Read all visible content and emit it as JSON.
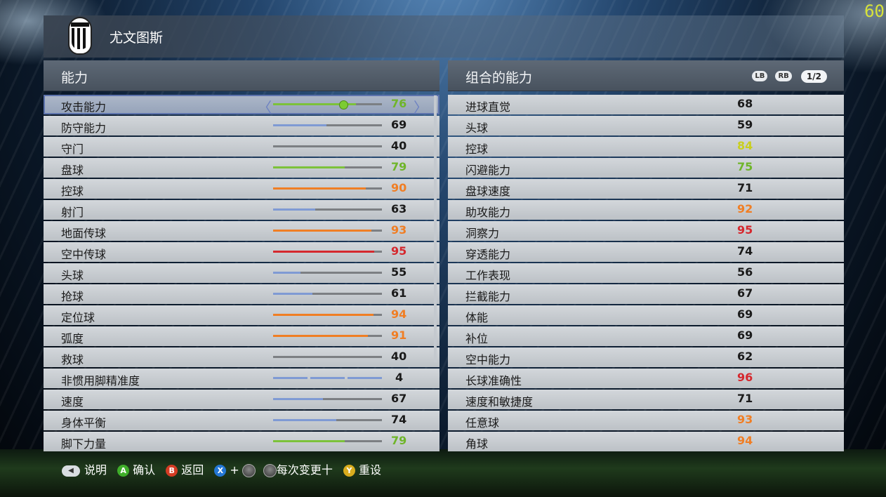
{
  "fps": "60",
  "header": {
    "team_name": "尤文图斯"
  },
  "left_panel": {
    "title": "能力",
    "rows": [
      {
        "label": "攻击能力",
        "value": "76",
        "level": 0.76,
        "bar_color": "#7cc23a",
        "value_color": "#6fb52a"
      },
      {
        "label": "防守能力",
        "value": "69",
        "level": 0.49,
        "bar_color": "#7f9ad4",
        "value_color": "#1a1a1a"
      },
      {
        "label": "守门",
        "value": "40",
        "level": 0.0,
        "bar_color": "#7f9ad4",
        "value_color": "#1a1a1a"
      },
      {
        "label": "盘球",
        "value": "79",
        "level": 0.66,
        "bar_color": "#7cc23a",
        "value_color": "#6fb52a"
      },
      {
        "label": "控球",
        "value": "90",
        "level": 0.85,
        "bar_color": "#f07e24",
        "value_color": "#f07e24"
      },
      {
        "label": "射门",
        "value": "63",
        "level": 0.39,
        "bar_color": "#7f9ad4",
        "value_color": "#1a1a1a"
      },
      {
        "label": "地面传球",
        "value": "93",
        "level": 0.9,
        "bar_color": "#f07e24",
        "value_color": "#f07e24"
      },
      {
        "label": "空中传球",
        "value": "95",
        "level": 0.93,
        "bar_color": "#d5282e",
        "value_color": "#d5282e"
      },
      {
        "label": "头球",
        "value": "55",
        "level": 0.25,
        "bar_color": "#7f9ad4",
        "value_color": "#1a1a1a"
      },
      {
        "label": "抢球",
        "value": "61",
        "level": 0.36,
        "bar_color": "#7f9ad4",
        "value_color": "#1a1a1a"
      },
      {
        "label": "定位球",
        "value": "94",
        "level": 0.92,
        "bar_color": "#f07e24",
        "value_color": "#f07e24"
      },
      {
        "label": "弧度",
        "value": "91",
        "level": 0.87,
        "bar_color": "#f07e24",
        "value_color": "#f07e24"
      },
      {
        "label": "救球",
        "value": "40",
        "level": 0.0,
        "bar_color": "#7f9ad4",
        "value_color": "#1a1a1a"
      },
      {
        "label": "非惯用脚精准度",
        "value": "4",
        "level": 1.0,
        "bar_color": "#7f9ad4",
        "value_color": "#1a1a1a"
      },
      {
        "label": "速度",
        "value": "67",
        "level": 0.46,
        "bar_color": "#7f9ad4",
        "value_color": "#1a1a1a"
      },
      {
        "label": "身体平衡",
        "value": "74",
        "level": 0.58,
        "bar_color": "#7f9ad4",
        "value_color": "#1a1a1a"
      },
      {
        "label": "脚下力量",
        "value": "79",
        "level": 0.66,
        "bar_color": "#7cc23a",
        "value_color": "#6fb52a"
      }
    ]
  },
  "right_panel": {
    "title": "组合的能力",
    "lb": "LB",
    "rb": "RB",
    "page": "1/2",
    "rows": [
      {
        "label": "进球直觉",
        "value": "68",
        "value_color": "#1a1a1a"
      },
      {
        "label": "头球",
        "value": "59",
        "value_color": "#1a1a1a"
      },
      {
        "label": "控球",
        "value": "84",
        "value_color": "#c9cf1e"
      },
      {
        "label": "闪避能力",
        "value": "75",
        "value_color": "#6fb52a"
      },
      {
        "label": "盘球速度",
        "value": "71",
        "value_color": "#1a1a1a"
      },
      {
        "label": "助攻能力",
        "value": "92",
        "value_color": "#f07e24"
      },
      {
        "label": "洞察力",
        "value": "95",
        "value_color": "#d5282e"
      },
      {
        "label": "穿透能力",
        "value": "74",
        "value_color": "#1a1a1a"
      },
      {
        "label": "工作表现",
        "value": "56",
        "value_color": "#1a1a1a"
      },
      {
        "label": "拦截能力",
        "value": "67",
        "value_color": "#1a1a1a"
      },
      {
        "label": "体能",
        "value": "69",
        "value_color": "#1a1a1a"
      },
      {
        "label": "补位",
        "value": "69",
        "value_color": "#1a1a1a"
      },
      {
        "label": "空中能力",
        "value": "62",
        "value_color": "#1a1a1a"
      },
      {
        "label": "长球准确性",
        "value": "96",
        "value_color": "#d5282e"
      },
      {
        "label": "速度和敏捷度",
        "value": "71",
        "value_color": "#1a1a1a"
      },
      {
        "label": "任意球",
        "value": "93",
        "value_color": "#f07e24"
      },
      {
        "label": "角球",
        "value": "94",
        "value_color": "#f07e24"
      }
    ]
  },
  "footer": {
    "back_label": "说明",
    "a_btn": "A",
    "a_label": "确认",
    "b_btn": "B",
    "b_label": "返回",
    "x_btn": "X",
    "plus": "+",
    "stick_label": "每次变更十",
    "y_btn": "Y",
    "y_label": "重设"
  }
}
